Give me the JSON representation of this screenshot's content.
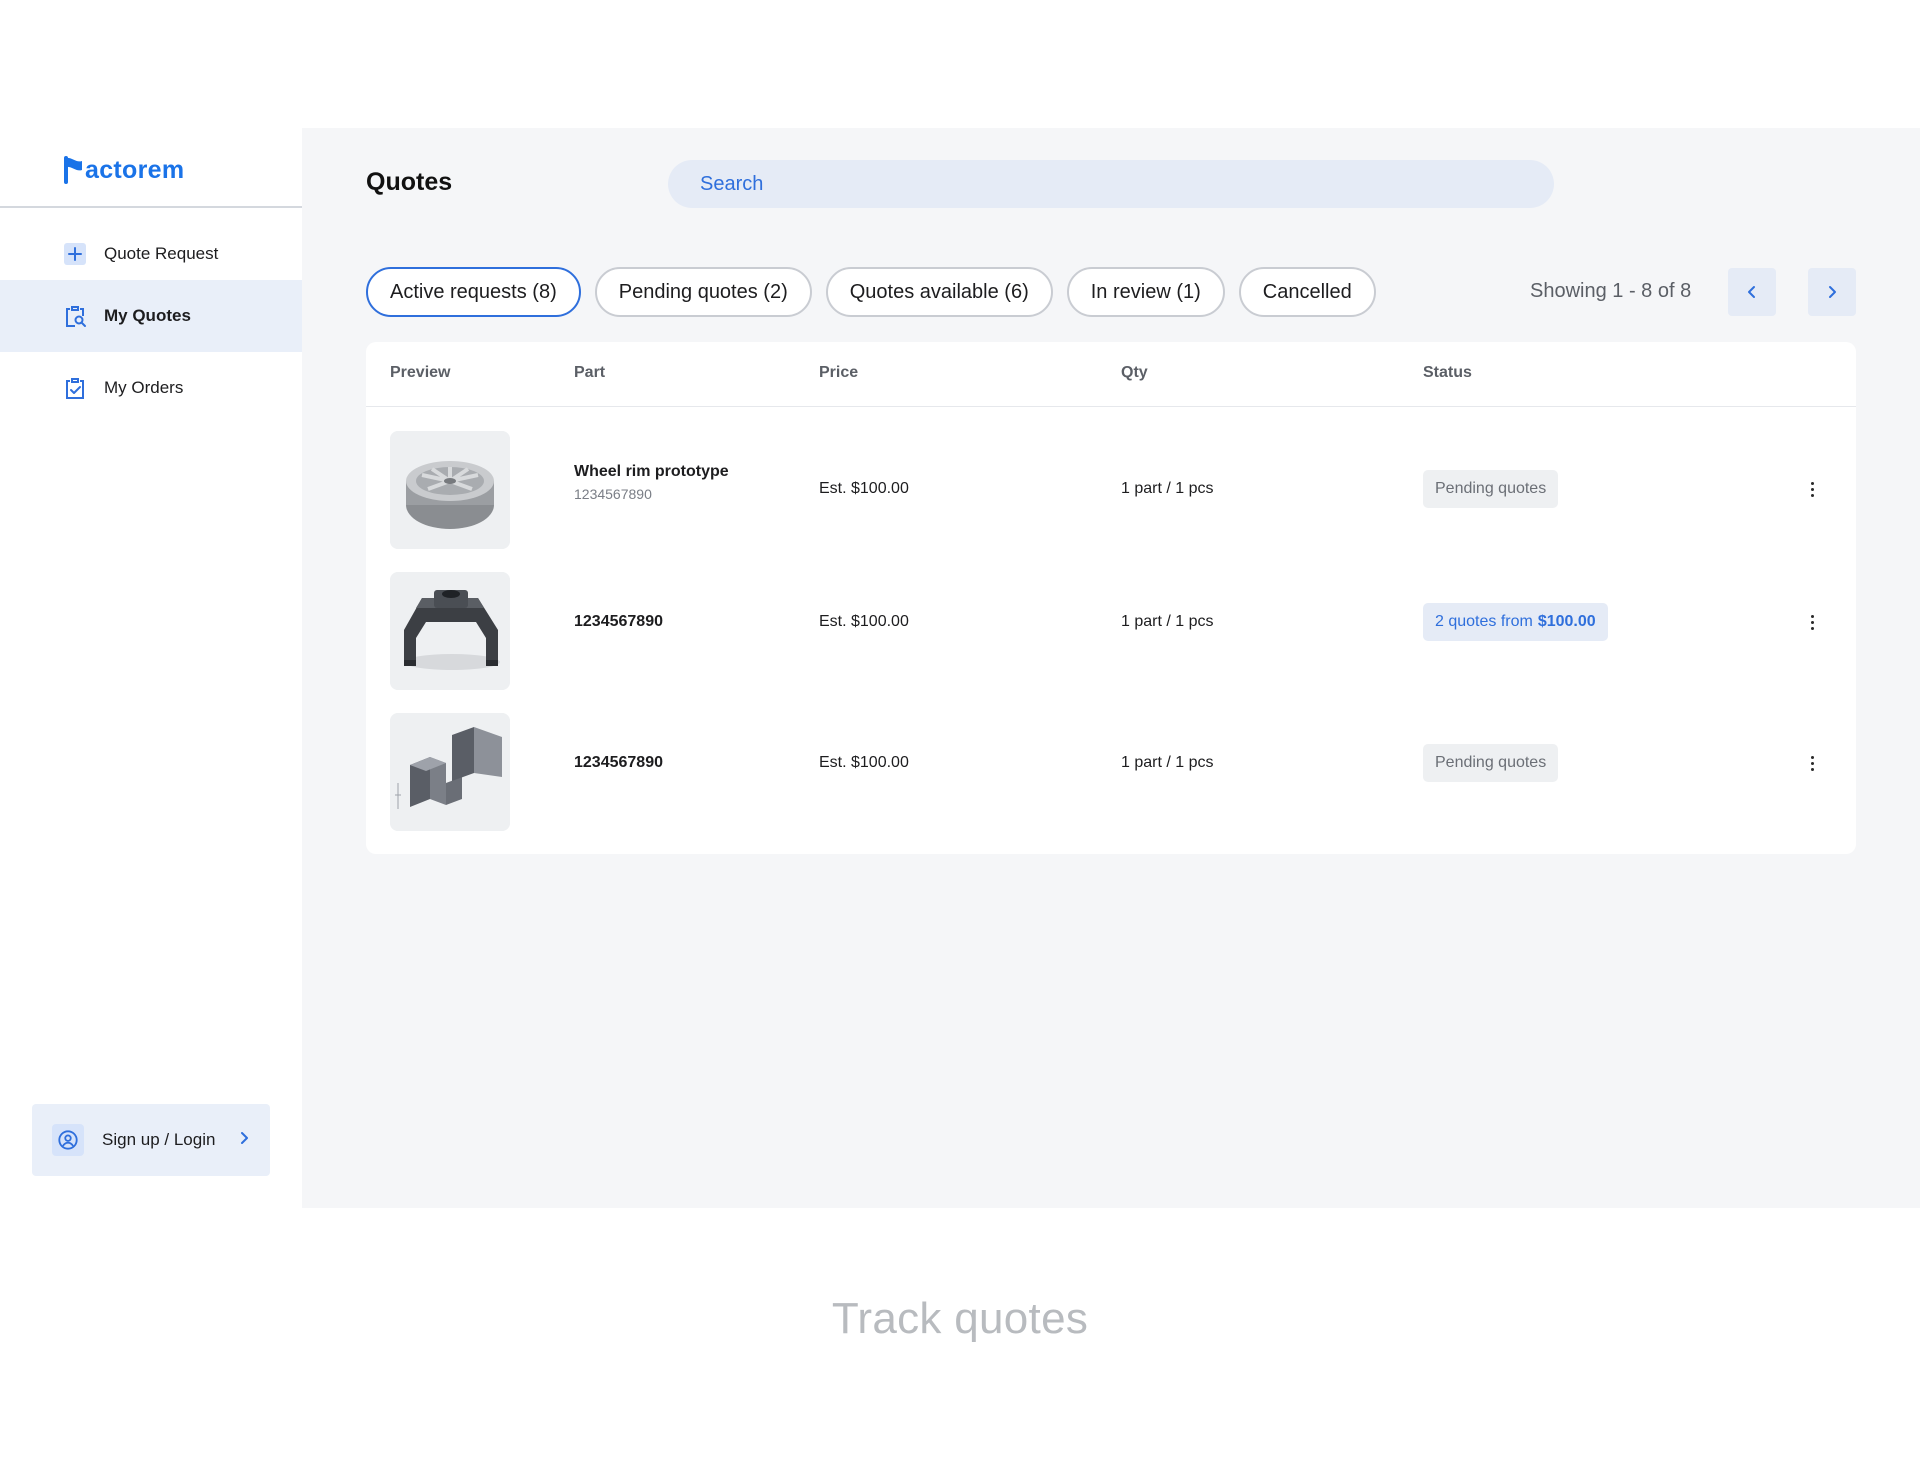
{
  "brand": {
    "name": "actorem",
    "color": "#1a73e8"
  },
  "sidebar": {
    "items": [
      {
        "label": "Quote Request",
        "icon": "plus-icon"
      },
      {
        "label": "My Quotes",
        "icon": "quote-search-icon",
        "active": true
      },
      {
        "label": "My Orders",
        "icon": "orders-check-icon"
      }
    ],
    "signup": {
      "label": "Sign up / Login",
      "icon": "user-circle-icon"
    }
  },
  "header": {
    "title": "Quotes",
    "search_placeholder": "Search"
  },
  "tabs": [
    {
      "label": "Active requests (8)",
      "active": true
    },
    {
      "label": "Pending quotes (2)"
    },
    {
      "label": "Quotes available (6)"
    },
    {
      "label": "In review (1)"
    },
    {
      "label": "Cancelled"
    }
  ],
  "pagination": {
    "showing": "Showing 1 - 8 of 8"
  },
  "table": {
    "columns": [
      "Preview",
      "Part",
      "Price",
      "Qty",
      "Status"
    ],
    "rows": [
      {
        "preview": "wheel-rim-image",
        "part": "Wheel rim prototype",
        "part_id": "1234567890",
        "price": "Est. $100.00",
        "qty": "1 part / 1 pcs",
        "status": "Pending quotes"
      },
      {
        "preview": "bracket-part-image",
        "part": "1234567890",
        "price": "Est. $100.00",
        "qty": "1 part / 1 pcs",
        "status_prefix": "2 quotes from",
        "status_amount": "$100.00"
      },
      {
        "preview": "block-part-image",
        "part": "1234567890",
        "price": "Est. $100.00",
        "qty": "1 part / 1 pcs",
        "status": "Pending quotes"
      }
    ]
  },
  "caption": "Track quotes",
  "colors": {
    "accent": "#2f6fdc",
    "active_bg": "#e9eff9",
    "main_bg": "#f5f6f8"
  }
}
